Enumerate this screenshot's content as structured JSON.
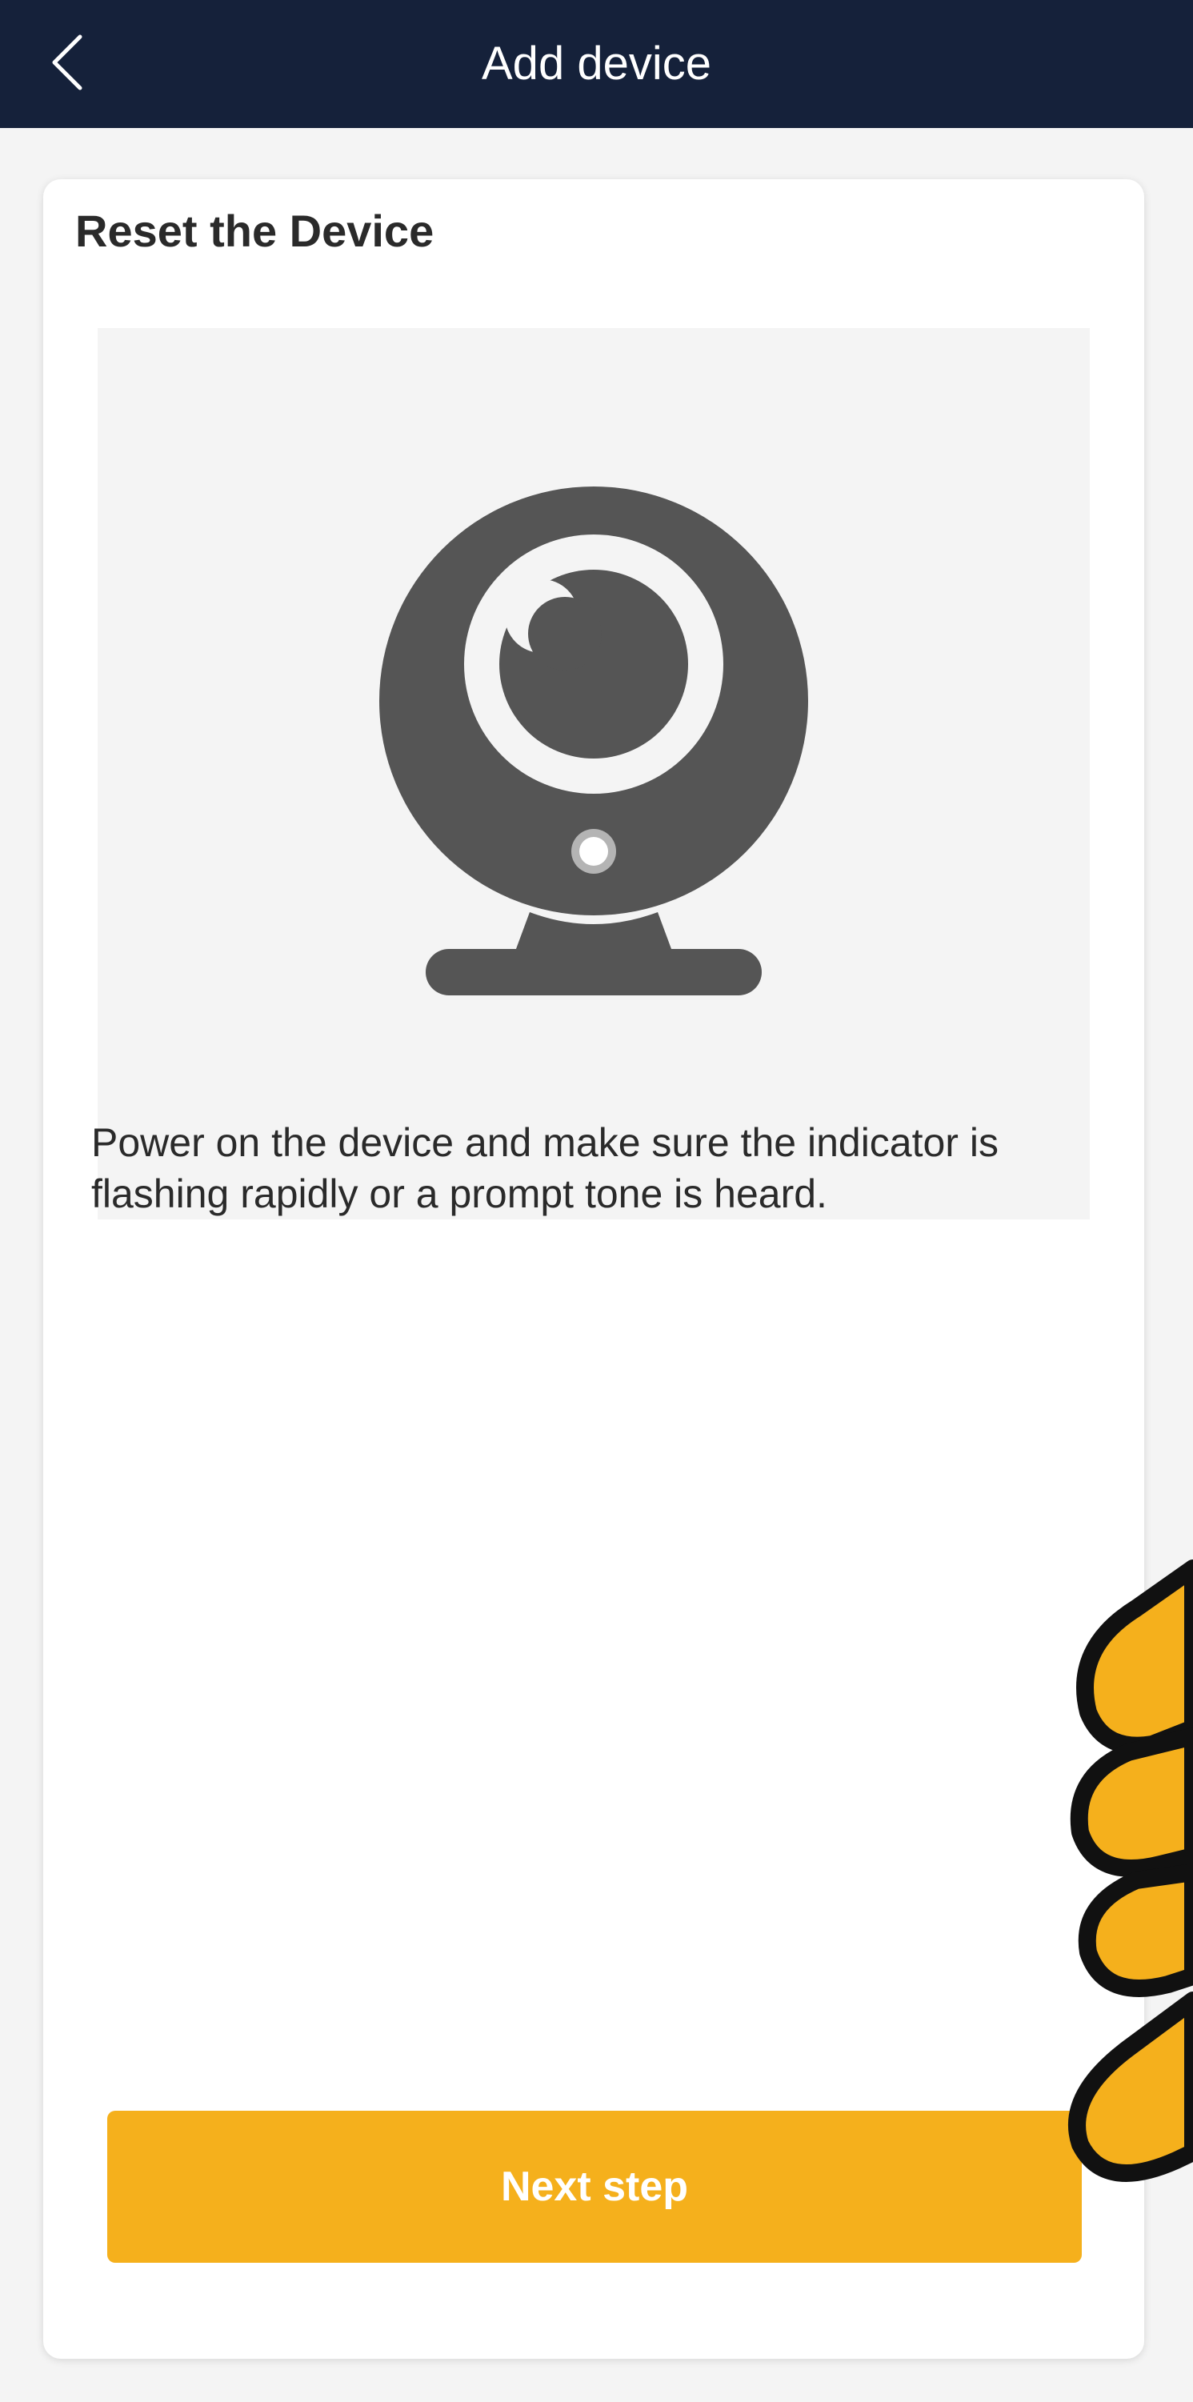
{
  "header": {
    "title": "Add device",
    "back_icon": "chevron-left-icon",
    "background_color": "#15213a"
  },
  "card": {
    "title": "Reset the Device",
    "illustration_icon": "webcam-icon",
    "description": "Power on the device and make sure the indicator is flashing rapidly or a prompt tone is heard.",
    "next_button_label": "Next step"
  },
  "colors": {
    "accent": "#f5b01c",
    "icon_gray": "#555555",
    "text": "#2a2a2a",
    "page_background": "#f4f4f4"
  }
}
